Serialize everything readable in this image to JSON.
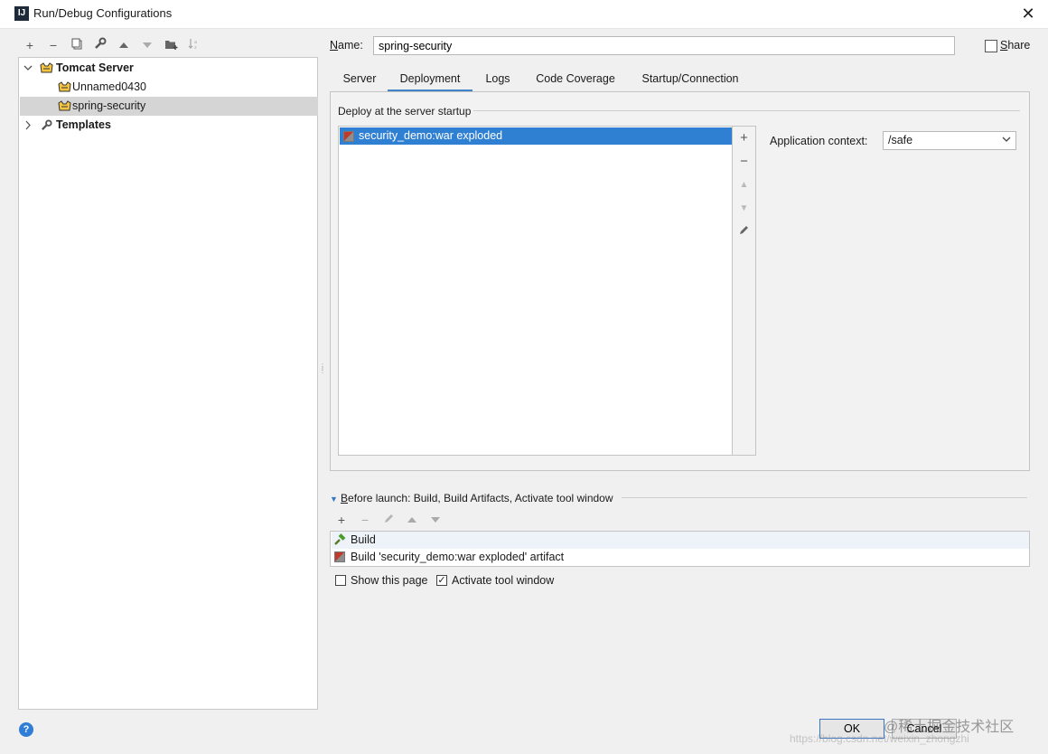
{
  "window": {
    "title": "Run/Debug Configurations",
    "app_icon_letter": "IJ"
  },
  "toolbar": {
    "icons": [
      "add-icon",
      "remove-icon",
      "copy-icon",
      "wrench-icon",
      "move-up-icon",
      "move-down-icon",
      "folder-add-icon",
      "sort-icon"
    ]
  },
  "tree": {
    "tomcat_server": "Tomcat Server",
    "items": [
      "Unnamed0430",
      "spring-security"
    ],
    "templates": "Templates"
  },
  "name": {
    "label": "Name:",
    "value": "spring-security"
  },
  "share": {
    "label": "Share",
    "checked": false
  },
  "tabs": [
    "Server",
    "Deployment",
    "Logs",
    "Code Coverage",
    "Startup/Connection"
  ],
  "active_tab": "Deployment",
  "deployment": {
    "section_label": "Deploy at the server startup",
    "artifacts": [
      "security_demo:war exploded"
    ],
    "app_context_label": "Application context:",
    "app_context_value": "/safe"
  },
  "before_launch": {
    "label": "Before launch: Build, Build Artifacts, Activate tool window",
    "items": [
      "Build",
      "Build 'security_demo:war exploded' artifact"
    ],
    "show_page_label": "Show this page",
    "show_page_checked": false,
    "activate_label": "Activate tool window",
    "activate_checked": true
  },
  "buttons": {
    "ok": "OK",
    "cancel": "Cancel"
  },
  "watermark": {
    "line1": "@稀土掘金技术社区",
    "line2": "https://blog.csdn.net/weixin_zhongzhi"
  },
  "colors": {
    "selection": "#2f7fd3",
    "tab_underline": "#4083c9",
    "help": "#2e7dd6"
  }
}
